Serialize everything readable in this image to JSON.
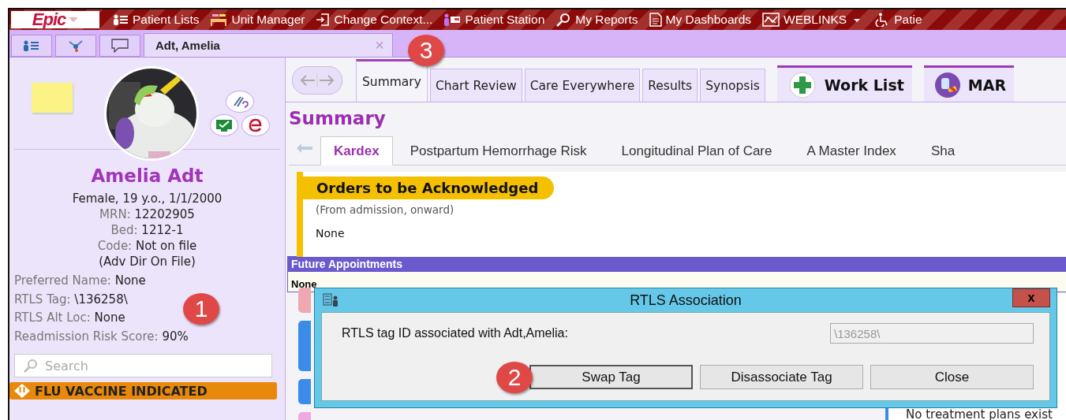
{
  "menu_bar": {
    "logo": "Epic",
    "logo_dropdown": true,
    "items": [
      {
        "label": "Patient Lists",
        "dropdown": false
      },
      {
        "label": "Unit Manager",
        "dropdown": false
      },
      {
        "label": "Change Context...",
        "dropdown": false
      },
      {
        "label": "Patient Station",
        "dropdown": false
      },
      {
        "label": "My Reports",
        "dropdown": false
      },
      {
        "label": "My Dashboards",
        "dropdown": false
      },
      {
        "label": "WEBLINKS",
        "dropdown": true
      },
      {
        "label": "Patie",
        "dropdown": false
      }
    ]
  },
  "workspace_tabs": [
    {
      "label": "Adt, Amelia",
      "selected": true,
      "close": "×"
    }
  ],
  "patient": {
    "name": "Amelia Adt",
    "header_lines": [
      {
        "value": "Female, 19 y.o., 1/1/2000"
      },
      {
        "label": "MRN:",
        "value": "12202905"
      },
      {
        "label": "Bed:",
        "value": "1212-1"
      },
      {
        "label": "Code:",
        "value": "Not on file"
      },
      {
        "value": "(Adv Dir On File)"
      }
    ],
    "details": [
      {
        "label": "Preferred Name:",
        "value": "None"
      },
      {
        "label": "RTLS Tag:",
        "value": "\\136258\\"
      },
      {
        "label": "RTLS Alt Loc:",
        "value": "None"
      },
      {
        "label": "Readmission Risk Score:",
        "value": "90%"
      }
    ],
    "search": {
      "placeholder": "Search"
    },
    "alert": "FLU VACCINE INDICATED"
  },
  "activity_tabs": [
    {
      "label": "Summary",
      "kind": "tab",
      "selected": true
    },
    {
      "label": "Chart Review",
      "kind": "tab",
      "selected": false
    },
    {
      "label": "Care Everywhere",
      "kind": "tab",
      "selected": false
    },
    {
      "label": "Results",
      "kind": "tab",
      "selected": false
    },
    {
      "label": "Synopsis",
      "kind": "tab",
      "selected": false
    },
    {
      "label": "Work List",
      "kind": "launcher",
      "selected": false
    },
    {
      "label": "MAR",
      "kind": "launcher",
      "selected": false
    }
  ],
  "page_title": "Summary",
  "sub_tabs": [
    {
      "label": "Kardex",
      "selected": true
    },
    {
      "label": "Postpartum Hemorrhage Risk",
      "selected": false
    },
    {
      "label": "Longitudinal Plan of Care",
      "selected": false
    },
    {
      "label": "A Master Index",
      "selected": false
    },
    {
      "label": "Sha",
      "selected": false
    }
  ],
  "orders": {
    "title": "Orders to be Acknowledged",
    "note": "(From admission, onward)",
    "body": "None"
  },
  "future_appointments": {
    "title": "Future Appointments",
    "body": "None"
  },
  "treatment_plans": {
    "body": "No treatment plans exist"
  },
  "dialog": {
    "title": "RTLS Association",
    "close": "x",
    "label": "RTLS tag ID associated with Adt,Amelia:",
    "field": {
      "value": "\\136258\\",
      "disabled": true
    },
    "buttons": [
      {
        "label": "Swap Tag",
        "default": true
      },
      {
        "label": "Disassociate Tag",
        "default": false
      },
      {
        "label": "Close",
        "default": false
      }
    ]
  },
  "annotations": [
    {
      "label": "1"
    },
    {
      "label": "2"
    },
    {
      "label": "3"
    }
  ]
}
